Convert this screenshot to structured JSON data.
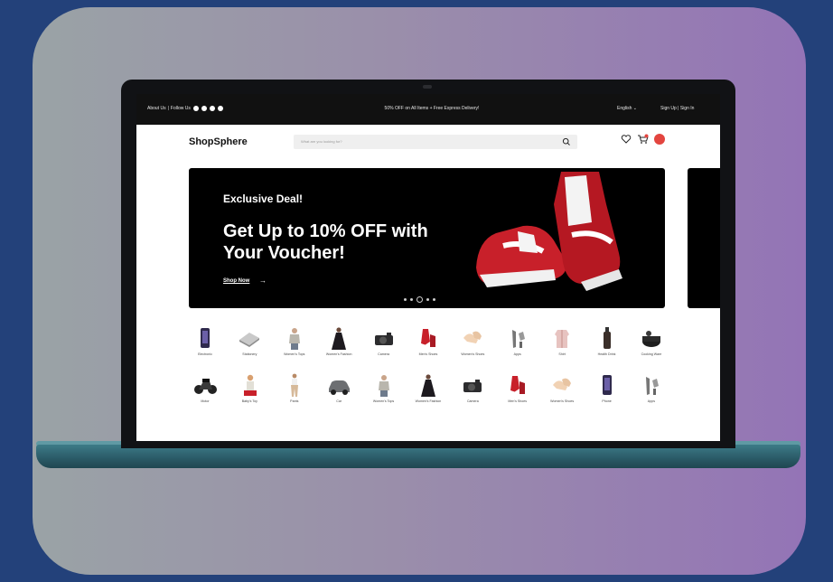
{
  "topbar": {
    "about": "About Us",
    "follow": "Follow Us",
    "promo": "50% OFF on All Items + Free Express Delivery!",
    "language": "English",
    "auth": "Sign Up | Sign In"
  },
  "header": {
    "logo": "ShopSphere",
    "search_placeholder": "What are you looking for?"
  },
  "banner": {
    "eyebrow": "Exclusive Deal!",
    "headline": "Get Up to 10% OFF with Your Voucher!",
    "cta": "Shop Now",
    "slides": 5,
    "active_slide": 3
  },
  "categories_row1": [
    {
      "label": "Electronic",
      "icon": "phone-icon"
    },
    {
      "label": "Stationery",
      "icon": "book-icon"
    },
    {
      "label": "Women's Tops",
      "icon": "top-icon"
    },
    {
      "label": "Women's Fashion",
      "icon": "dress-icon"
    },
    {
      "label": "Camera",
      "icon": "camera-icon"
    },
    {
      "label": "Men's Shoes",
      "icon": "sneaker-icon"
    },
    {
      "label": "Women's Shoes",
      "icon": "heels-icon"
    },
    {
      "label": "Apps",
      "icon": "apps-icon"
    },
    {
      "label": "Shirt",
      "icon": "shirt-icon"
    },
    {
      "label": "Health Drink",
      "icon": "bottle-icon"
    },
    {
      "label": "Cooking Ware",
      "icon": "pot-icon"
    }
  ],
  "categories_row2": [
    {
      "label": "Motor",
      "icon": "motorbike-icon"
    },
    {
      "label": "Baby's Toy",
      "icon": "toy-icon"
    },
    {
      "label": "Pants",
      "icon": "pants-icon"
    },
    {
      "label": "Car",
      "icon": "car-icon"
    },
    {
      "label": "Women's Tops",
      "icon": "top-icon"
    },
    {
      "label": "Women's Fashion",
      "icon": "dress-icon"
    },
    {
      "label": "Camera",
      "icon": "camera-icon"
    },
    {
      "label": "Men's Shoes",
      "icon": "sneaker-icon"
    },
    {
      "label": "Women's Shoes",
      "icon": "heels-icon"
    },
    {
      "label": "Phone",
      "icon": "phone-icon"
    },
    {
      "label": "Apps",
      "icon": "apps-icon"
    }
  ],
  "colors": {
    "background": "#23417a",
    "banner": "#000000",
    "accent_red": "#c8202a",
    "avatar": "#e3453f"
  }
}
